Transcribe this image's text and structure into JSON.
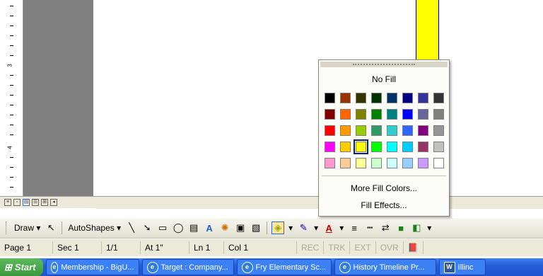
{
  "ruler": {
    "numbers": [
      "3",
      "4"
    ]
  },
  "view_buttons": [
    "normal",
    "web",
    "print",
    "outline",
    "reading"
  ],
  "toolbar": {
    "draw_label": "Draw",
    "autoshapes_label": "AutoShapes"
  },
  "fill_menu": {
    "no_fill": "No Fill",
    "more_fill_colors": "More Fill Colors...",
    "fill_effects": "Fill Effects...",
    "selected_index": 26,
    "colors": [
      "#000000",
      "#993300",
      "#333300",
      "#003300",
      "#003366",
      "#000080",
      "#333399",
      "#333333",
      "#800000",
      "#FF6600",
      "#808000",
      "#008000",
      "#008080",
      "#0000FF",
      "#666699",
      "#808080",
      "#FF0000",
      "#FF9900",
      "#99CC00",
      "#339966",
      "#33CCCC",
      "#3366FF",
      "#800080",
      "#969696",
      "#FF00FF",
      "#FFCC00",
      "#FFFF00",
      "#00FF00",
      "#00FFFF",
      "#00CCFF",
      "#993366",
      "#C0C0C0",
      "#FF99CC",
      "#FFCC99",
      "#FFFF99",
      "#CCFFCC",
      "#CCFFFF",
      "#99CCFF",
      "#CC99FF",
      "#FFFFFF"
    ]
  },
  "status": {
    "page": "Page 1",
    "sec": "Sec 1",
    "pages": "1/1",
    "at": "At 1\"",
    "ln": "Ln 1",
    "col": "Col 1",
    "rec": "REC",
    "trk": "TRK",
    "ext": "EXT",
    "ovr": "OVR"
  },
  "taskbar": {
    "start": "Start",
    "tasks": [
      "Membership - BigU...",
      "Target : Company...",
      "Fry Elementary Sc...",
      "History Timeline Pr...",
      "Illinc"
    ]
  },
  "colors": {
    "page_fill": "#FFFF00",
    "gutter": "#808080"
  }
}
